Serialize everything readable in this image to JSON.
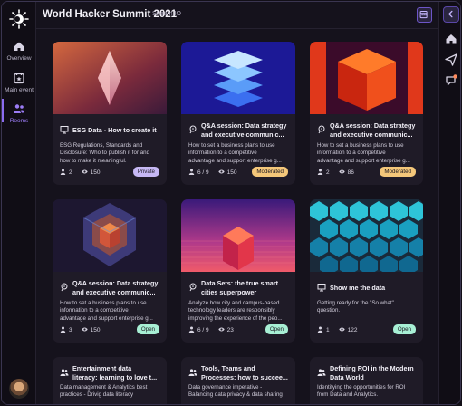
{
  "app": {
    "title": "World Hacker Summit 2021",
    "subtitle": "Stream.IO"
  },
  "nav": {
    "items": [
      {
        "label": "Overview",
        "icon": "home-icon"
      },
      {
        "label": "Main event",
        "icon": "calendar-star-icon"
      },
      {
        "label": "Rooms",
        "icon": "people-icon",
        "active": true
      }
    ]
  },
  "right_rail": {
    "buttons": [
      "collapse-icon",
      "home-icon",
      "send-icon",
      "chat-notification-icon"
    ]
  },
  "colors": {
    "accent": "#8b6cf0",
    "private": "#c6b8f4",
    "moderated": "#f4c77a",
    "open": "#a7efd4"
  },
  "cards": [
    {
      "title1": "ESG Data - How to create it",
      "title2": "",
      "desc1": "ESG Regulations, Standards and",
      "desc2": "Disclosure: Who to publish it for and",
      "desc3": "how to make it meaningful.",
      "people": "2",
      "views": "150",
      "badge": "Private",
      "type_icon": "presentation-icon"
    },
    {
      "title1": "Q&A session: Data strategy",
      "title2": "and executive communic...",
      "desc1": "How to set a business plans to use",
      "desc2": "information to a competitive",
      "desc3": "advantage and support enterprise g...",
      "people": "6 / 9",
      "views": "150",
      "badge": "Moderated",
      "type_icon": "qa-icon"
    },
    {
      "title1": "Q&A session: Data strategy",
      "title2": "and executive communic...",
      "desc1": "How to set a business plans to use",
      "desc2": "information to a competitive",
      "desc3": "advantage and support enterprise g...",
      "people": "2",
      "views": "86",
      "badge": "Moderated",
      "type_icon": "qa-icon"
    },
    {
      "title1": "Q&A session: Data strategy",
      "title2": "and executive communic...",
      "desc1": "How to set a business plans to use",
      "desc2": "information to a competitive",
      "desc3": "advantage and support enterprise g...",
      "people": "3",
      "views": "150",
      "badge": "Open",
      "type_icon": "qa-icon"
    },
    {
      "title1": "Data Sets: the true smart",
      "title2": "cities superpower",
      "desc1": "Analyze how city and campus-based",
      "desc2": "technology leaders are responsibly",
      "desc3": "improving the experience of the peo...",
      "people": "6 / 9",
      "views": "23",
      "badge": "Open",
      "type_icon": "qa-icon"
    },
    {
      "title1": "Show me the data",
      "title2": "",
      "desc1": "Getting ready for the \"So what\"",
      "desc2": "question.",
      "desc3": "",
      "people": "1",
      "views": "122",
      "badge": "Open",
      "type_icon": "presentation-icon"
    },
    {
      "title1": "Entertainment data",
      "title2": "literacy: learning to love t...",
      "desc1": "Data management & Analytics best",
      "desc2": "practices - Drivig data literacy",
      "desc3": "",
      "type_icon": "people-icon"
    },
    {
      "title1": "Tools, Teams and",
      "title2": "Processes: how to succee...",
      "desc1": "Data governance imperative -",
      "desc2": "Balancing data privacy & data sharing",
      "desc3": "",
      "type_icon": "people-icon"
    },
    {
      "title1": "Defining ROI in the Modern",
      "title2": "Data World",
      "desc1": "Identifying the opportunities for ROI",
      "desc2": "from Data and Analytics.",
      "desc3": "",
      "type_icon": "people-icon"
    }
  ]
}
